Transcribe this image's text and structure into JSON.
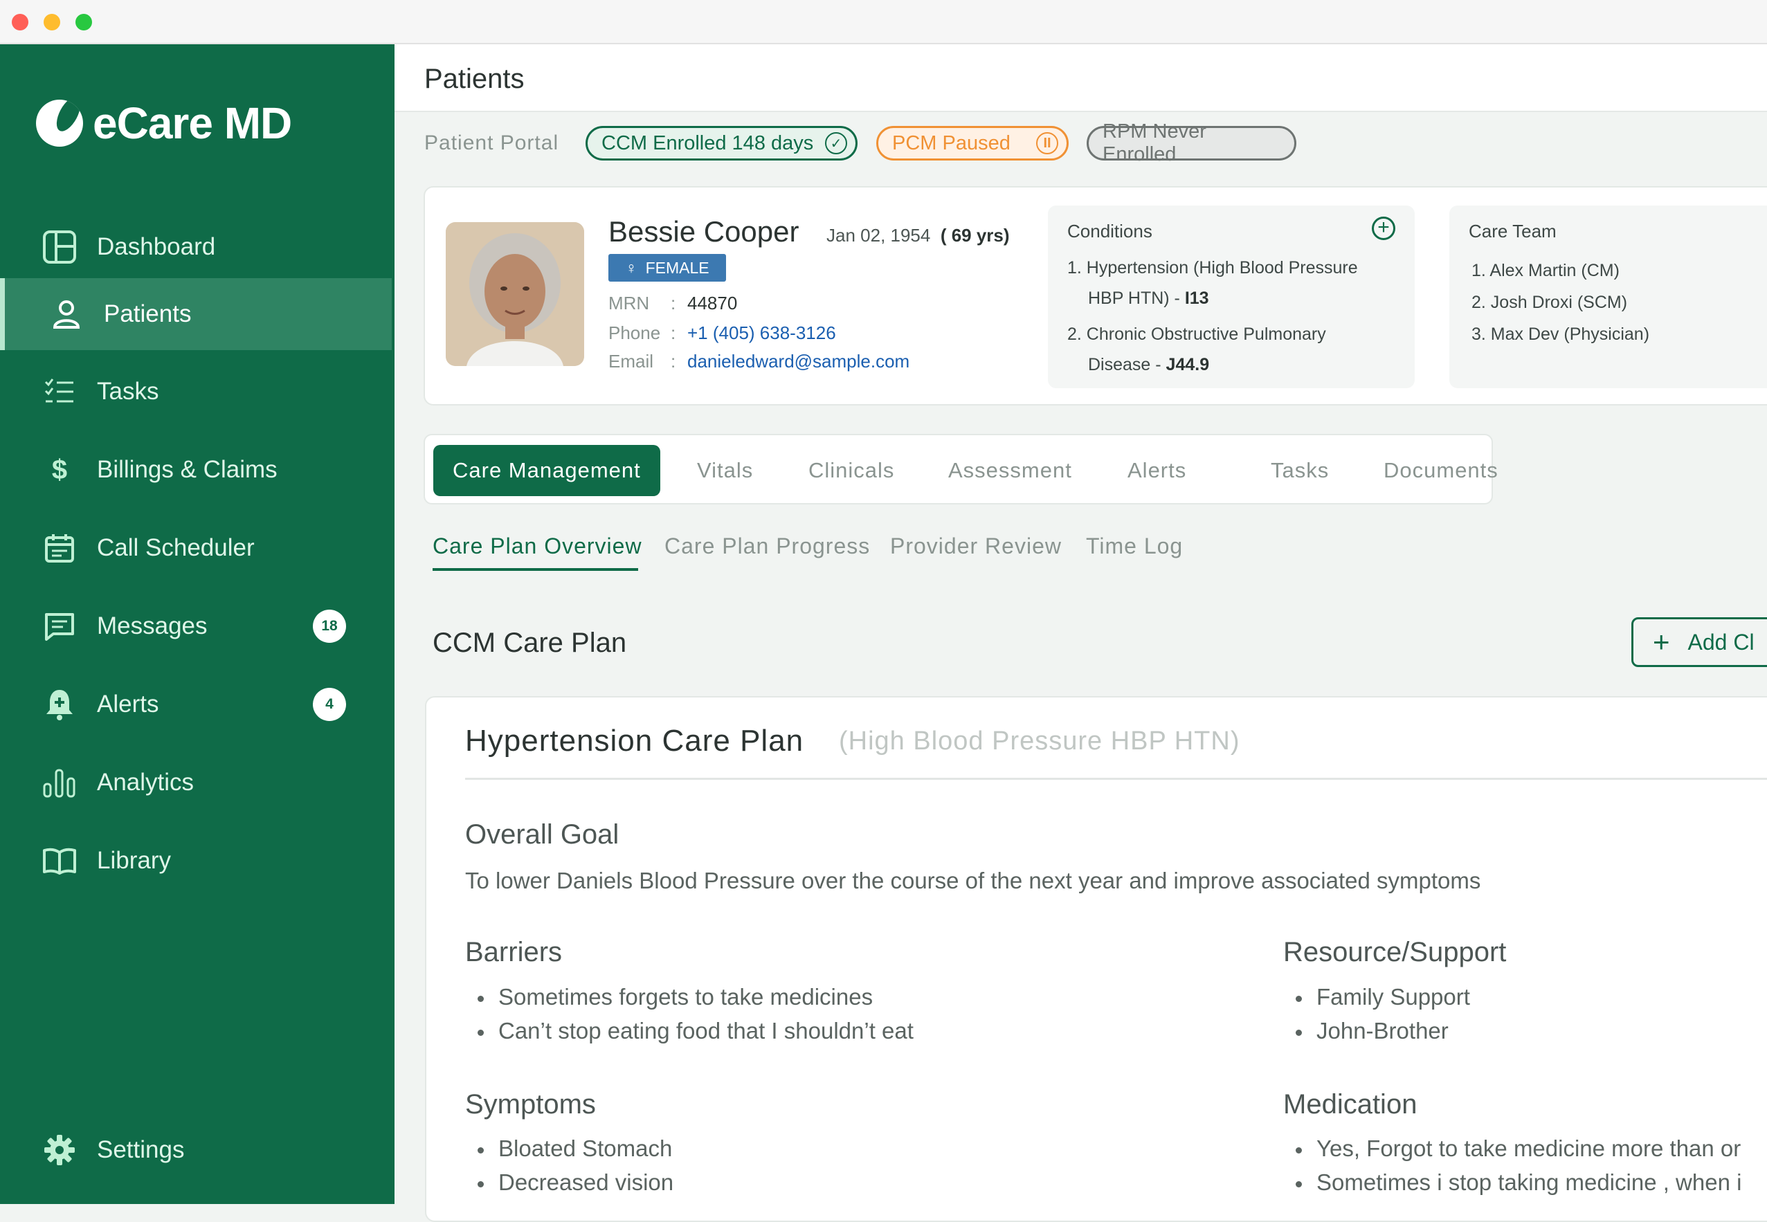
{
  "window": {
    "controls": [
      "close",
      "minimize",
      "zoom"
    ]
  },
  "brand": {
    "name": "eCare MD"
  },
  "sidebar": {
    "items": [
      {
        "label": "Dashboard",
        "icon": "dashboard-icon"
      },
      {
        "label": "Patients",
        "icon": "user-icon",
        "active": true
      },
      {
        "label": "Tasks",
        "icon": "checklist-icon"
      },
      {
        "label": "Billings & Claims",
        "icon": "dollar-icon"
      },
      {
        "label": "Call Scheduler",
        "icon": "calendar-icon"
      },
      {
        "label": "Messages",
        "icon": "message-icon",
        "badge": "18"
      },
      {
        "label": "Alerts",
        "icon": "bell-icon",
        "badge": "4"
      },
      {
        "label": "Analytics",
        "icon": "analytics-icon"
      },
      {
        "label": "Library",
        "icon": "book-icon"
      }
    ],
    "settings": {
      "label": "Settings",
      "icon": "gear-icon"
    }
  },
  "header": {
    "title": "Patients"
  },
  "portal": {
    "label": "Patient Portal",
    "statuses": [
      {
        "label": "CCM Enrolled 148 days",
        "icon": "check-icon",
        "color": "#0f6b48"
      },
      {
        "label": "PCM Paused",
        "icon": "pause-icon",
        "color": "#f09134"
      },
      {
        "label": "RPM Never Enrolled",
        "color": "#6e7472"
      }
    ]
  },
  "patient": {
    "name": "Bessie Cooper",
    "dob": "Jan 02, 1954",
    "age": "( 69 yrs)",
    "gender": "FEMALE",
    "mrn_label": "MRN",
    "mrn": "44870",
    "phone_label": "Phone",
    "phone": "+1 (405) 638-3126",
    "email_label": "Email",
    "email": "danieledward@sample.com"
  },
  "conditions": {
    "title": "Conditions",
    "items": [
      {
        "line1": "1. Hypertension (High Blood Pressure",
        "line2": "HBP HTN) - ",
        "code": "I13"
      },
      {
        "line1": "2. Chronic Obstructive Pulmonary",
        "line2": "Disease - ",
        "code": "J44.9"
      }
    ]
  },
  "care_team": {
    "title": "Care Team",
    "members": [
      "1. Alex Martin (CM)",
      "2. Josh Droxi (SCM)",
      "3. Max Dev (Physician)"
    ]
  },
  "tabs": [
    "Care Management",
    "Vitals",
    "Clinicals",
    "Assessment",
    "Alerts",
    "Tasks",
    "Documents"
  ],
  "subtabs": [
    "Care Plan Overview",
    "Care Plan Progress",
    "Provider Review",
    "Time Log"
  ],
  "care_plan": {
    "section_title": "CCM Care Plan",
    "add_button": "Add Cl",
    "title": "Hypertension Care Plan",
    "subtitle": "(High Blood Pressure HBP HTN)",
    "goal_heading": "Overall Goal",
    "goal_text": "To lower Daniels Blood Pressure over the course of the next year and improve associated symptoms",
    "barriers_heading": "Barriers",
    "barriers": [
      "Sometimes forgets to take medicines",
      "Can’t stop eating food that I shouldn’t eat"
    ],
    "resources_heading": "Resource/Support",
    "resources": [
      "Family Support",
      "John-Brother"
    ],
    "symptoms_heading": "Symptoms",
    "symptoms": [
      "Bloated Stomach",
      "Decreased vision"
    ],
    "medication_heading": "Medication",
    "medication": [
      "Yes, Forgot to take medicine more than or",
      "Sometimes i stop taking medicine , when i"
    ]
  }
}
